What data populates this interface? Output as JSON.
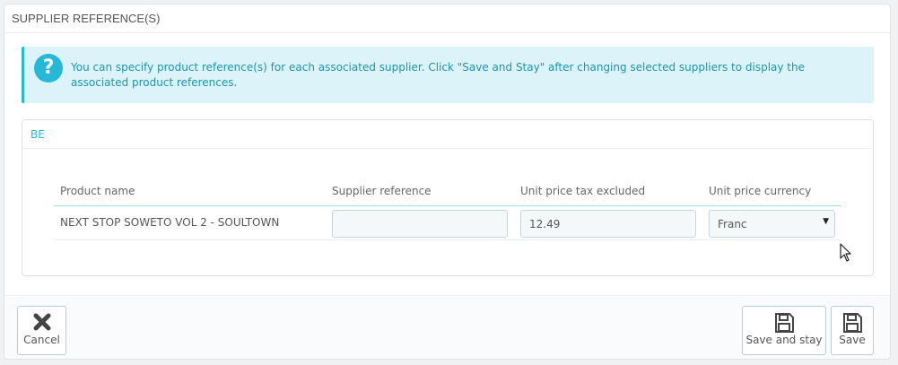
{
  "panel": {
    "title": "SUPPLIER REFERENCE(S)"
  },
  "alert": {
    "icon": "question-icon",
    "text": "You can specify product reference(s) for each associated supplier. Click \"Save and Stay\" after changing selected suppliers to display the associated product references."
  },
  "supplier": {
    "name": "BE",
    "columns": [
      "Product name",
      "Supplier reference",
      "Unit price tax excluded",
      "Unit price currency"
    ],
    "rows": [
      {
        "product_name": "NEXT STOP SOWETO VOL 2 - SOULTOWN",
        "supplier_reference": "",
        "unit_price": "12.49",
        "currency": "Franc"
      }
    ]
  },
  "footer": {
    "cancel_label": "Cancel",
    "save_stay_label": "Save and stay",
    "save_label": "Save"
  },
  "colors": {
    "accent": "#25b9d7",
    "alert_bg": "#dcf4f9",
    "alert_text": "#1e94ab"
  }
}
